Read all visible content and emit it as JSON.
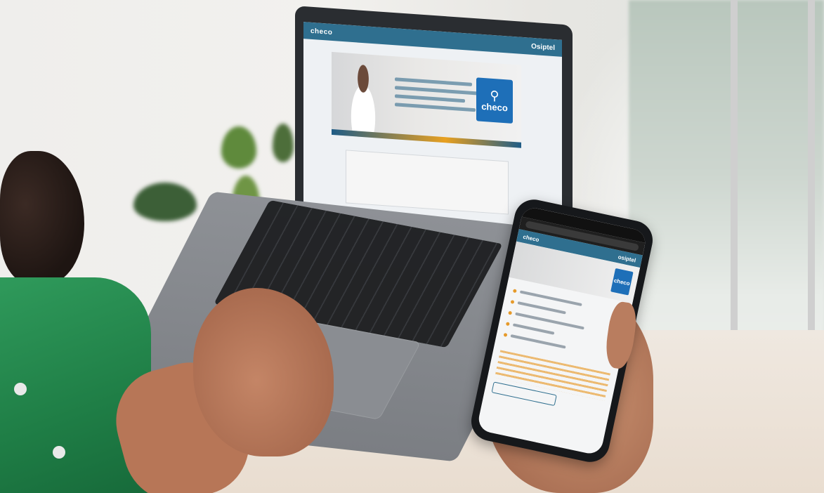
{
  "scene": {
    "description_colors": {
      "wall": "#f2f1ee",
      "shirt": "#2f9a5b",
      "brand_teal": "#2f6f8f",
      "brand_blue": "#1e6fb8",
      "accent_orange": "#e8a020"
    }
  },
  "laptop": {
    "header_logo": "checo",
    "header_brand": "Osiptel",
    "badge_icon": "search-icon",
    "badge_word": "checo"
  },
  "phone": {
    "header_logo": "checo",
    "header_brand": "osiptel",
    "badge_word": "checo"
  }
}
